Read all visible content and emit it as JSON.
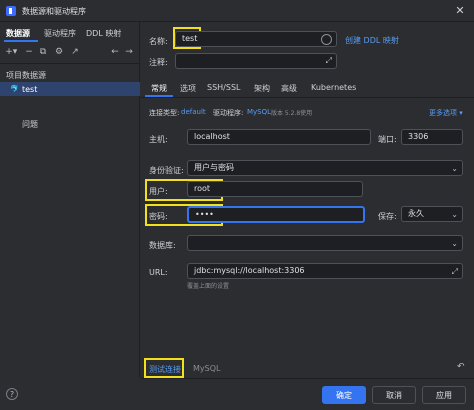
{
  "window": {
    "title": "数据源和驱动程序",
    "close_icon": "close-icon"
  },
  "left": {
    "tabs": [
      "数据源",
      "驱动程序",
      "DDL 映射"
    ],
    "toolbar_icons": [
      "+",
      "▾",
      "−",
      "⧉",
      "⚙",
      "↗",
      "←",
      "→"
    ],
    "section": "项目数据源",
    "datasource": "test",
    "problems": "问题"
  },
  "form": {
    "name_label": "名称:",
    "name_value": "test",
    "create_ddl": "创建 DDL 映射",
    "comment_label": "注释:",
    "tabs": [
      "常规",
      "选项",
      "SSH/SSL",
      "架构",
      "高级",
      "Kubernetes"
    ],
    "conn_type_label": "连接类型:",
    "conn_type_value": "default",
    "driver_label": "驱动程序:",
    "driver_value": "MySQL",
    "driver_version": "版本 5.2.8使用",
    "more_options": "更多选项 ▾",
    "host_label": "主机:",
    "host_value": "localhost",
    "port_label": "端口:",
    "port_value": "3306",
    "auth_label": "身份验证:",
    "auth_value": "用户与密码",
    "user_label": "用户:",
    "user_value": "root",
    "pwd_label": "密码:",
    "pwd_value": "••••",
    "save_label": "保存:",
    "save_value": "永久",
    "db_label": "数据库:",
    "db_value": "",
    "url_label": "URL:",
    "url_value": "jdbc:mysql://localhost:3306",
    "url_hint": "覆盖上面的设置"
  },
  "bottom": {
    "test_conn": "测试连接",
    "test_driver": "MySQL",
    "ok": "确定",
    "cancel": "取消",
    "apply": "应用",
    "help": "?"
  }
}
